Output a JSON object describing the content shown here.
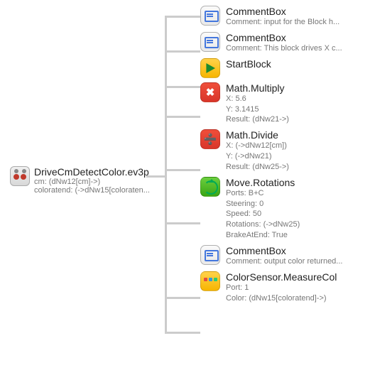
{
  "root": {
    "title": "DriveCmDetectColor.ev3p",
    "sub1": "cm: (dNw12[cm]->)",
    "sub2": "coloratend: (->dNw15[coloraten..."
  },
  "children": [
    {
      "iconClass": "ic-comment",
      "title": "CommentBox",
      "subs": [
        "Comment: input for the Block h..."
      ]
    },
    {
      "iconClass": "ic-comment",
      "title": "CommentBox",
      "subs": [
        "Comment: This block drives X c..."
      ]
    },
    {
      "iconClass": "ic-start",
      "title": "StartBlock",
      "subs": []
    },
    {
      "iconClass": "ic-math",
      "glyph": "✖",
      "title": "Math.Multiply",
      "subs": [
        "X: 5.6",
        "Y: 3.1415",
        "Result: (dNw21->)"
      ]
    },
    {
      "iconClass": "ic-math",
      "glyph": "➗",
      "title": "Math.Divide",
      "subs": [
        "X: (->dNw12[cm])",
        "Y: (->dNw21)",
        "Result: (dNw25->)"
      ]
    },
    {
      "iconClass": "ic-move",
      "title": "Move.Rotations",
      "subs": [
        "Ports: B+C",
        "Steering: 0",
        "Speed: 50",
        "Rotations: (->dNw25)",
        "BrakeAtEnd: True"
      ]
    },
    {
      "iconClass": "ic-comment",
      "title": "CommentBox",
      "subs": [
        "Comment: output color returned..."
      ]
    },
    {
      "iconClass": "ic-color",
      "title": "ColorSensor.MeasureCol",
      "subs": [
        "Port: 1",
        "Color: (dNw15[coloratend]->)"
      ]
    }
  ],
  "hOffsets": [
    22,
    71,
    121,
    163,
    238,
    313,
    418,
    467
  ]
}
